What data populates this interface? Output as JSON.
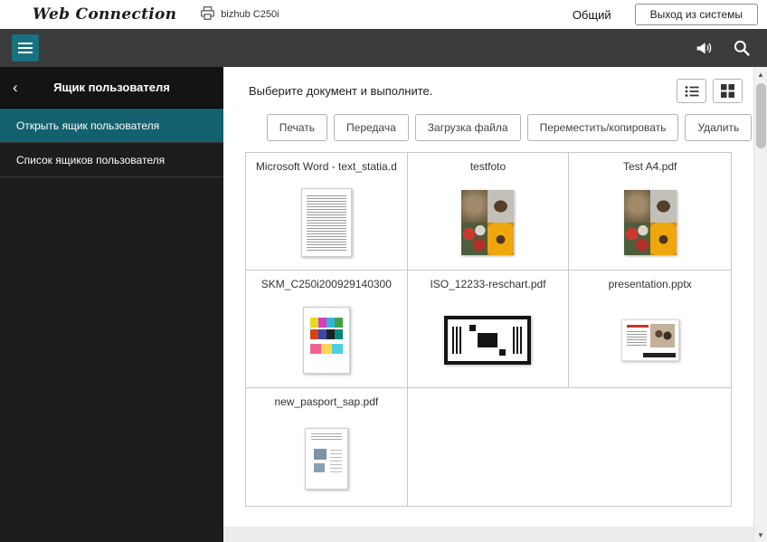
{
  "header": {
    "logo": "Web Connection",
    "device_model": "bizhub C250i",
    "account": "Общий",
    "logout_label": "Выход из системы"
  },
  "sidebar": {
    "back_icon": "‹",
    "title": "Ящик пользователя",
    "items": [
      {
        "label": "Открыть ящик пользователя",
        "selected": true
      },
      {
        "label": "Список ящиков пользователя",
        "selected": false
      }
    ]
  },
  "main": {
    "instruction": "Выберите документ и выполните.",
    "actions": [
      "Печать",
      "Передача",
      "Загрузка файла",
      "Переместить/копировать",
      "Удалить"
    ],
    "documents": [
      {
        "name": "Microsoft Word - text_statia.d",
        "type": "word-document"
      },
      {
        "name": "testfoto",
        "type": "photo-collage"
      },
      {
        "name": "Test A4.pdf",
        "type": "photo-collage"
      },
      {
        "name": "SKM_C250i200929140300",
        "type": "color-chart"
      },
      {
        "name": "ISO_12233-reschart.pdf",
        "type": "test-chart"
      },
      {
        "name": "presentation.pptx",
        "type": "presentation"
      },
      {
        "name": "new_pasport_sap.pdf",
        "type": "scanned-document"
      }
    ]
  },
  "scrollbar": {
    "up_glyph": "▲",
    "down_glyph": "▼"
  },
  "colors": {
    "accent_teal": "#17717f",
    "selected_item": "#13606e",
    "toolbar_dark": "#3b3b3b",
    "sidebar_dark": "#1d1d1d"
  }
}
